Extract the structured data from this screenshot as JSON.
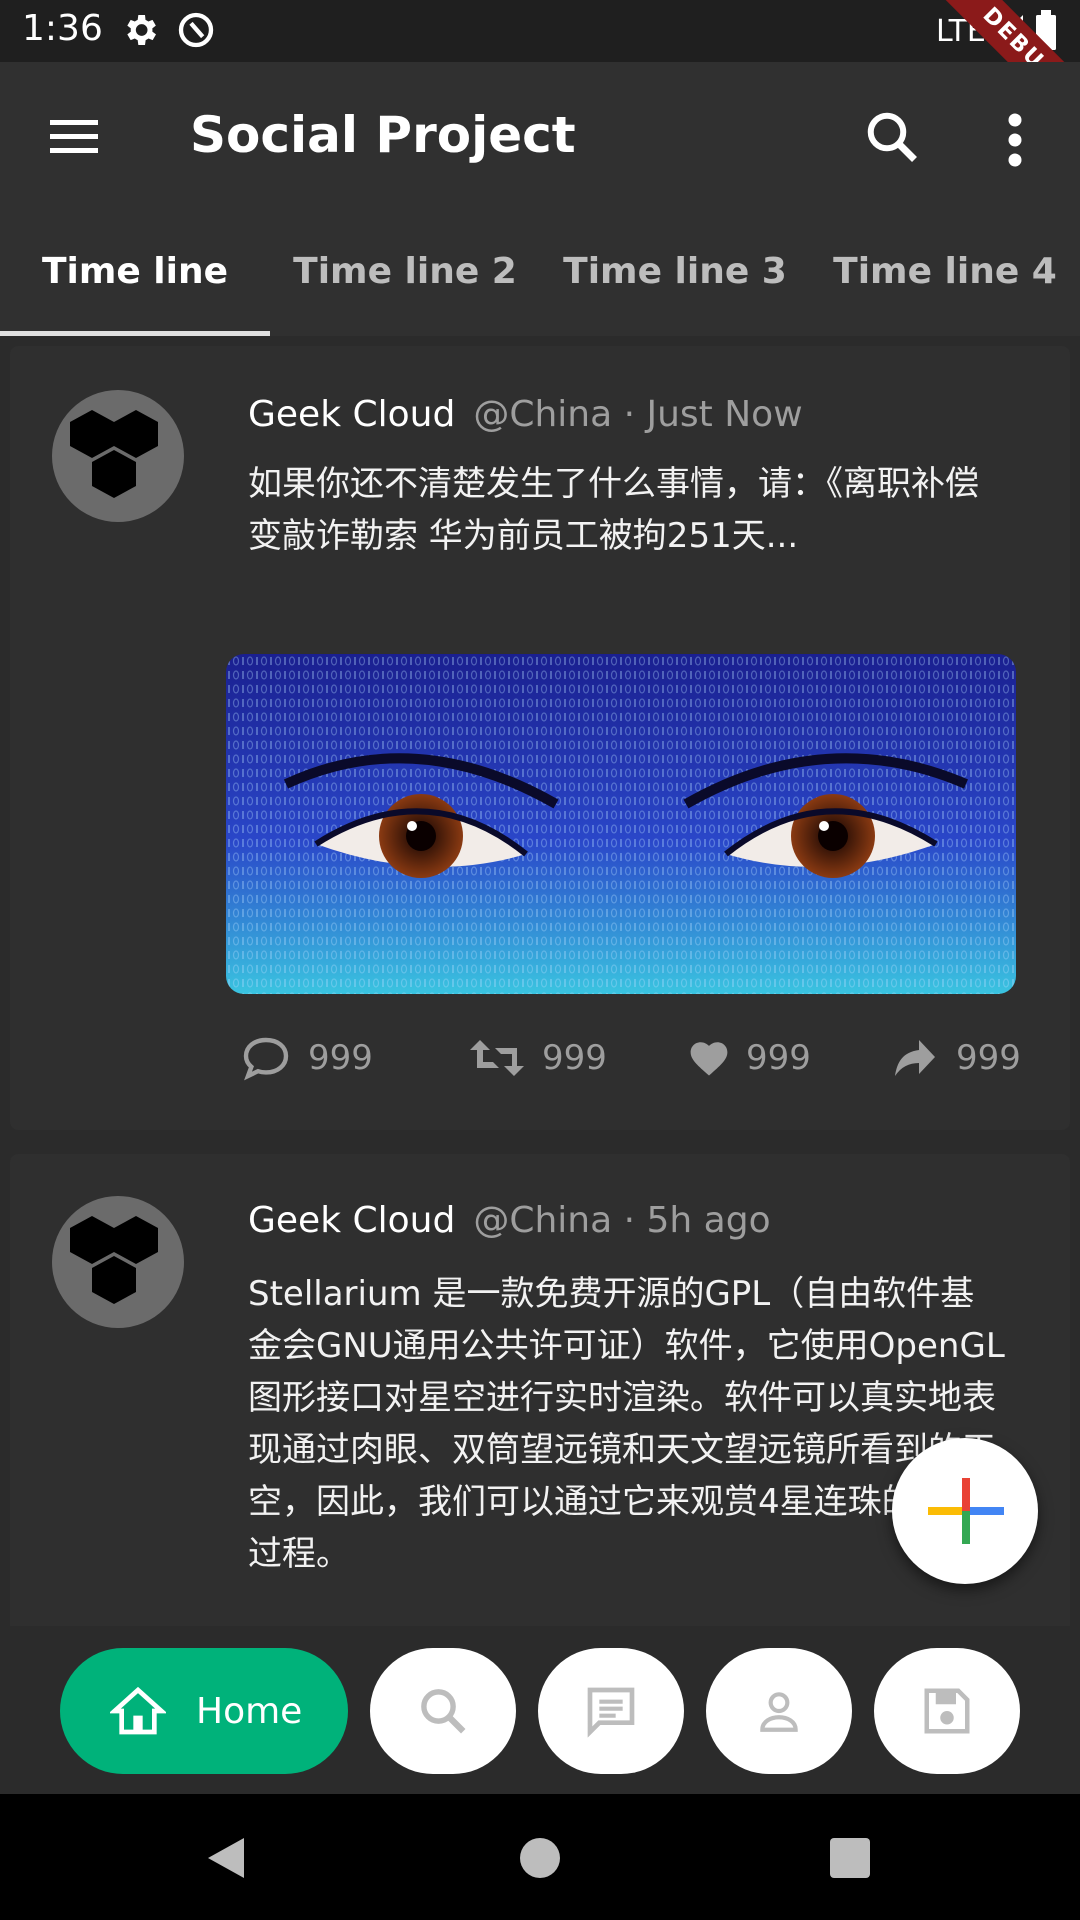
{
  "status_bar": {
    "time": "1:36",
    "network": "LTE",
    "debug_label": "DEBUG",
    "icons": [
      "settings-icon",
      "data-saver-icon",
      "signal-icon",
      "battery-icon"
    ]
  },
  "app_bar": {
    "title": "Social Project",
    "icons": [
      "menu-icon",
      "search-icon",
      "more-vert-icon"
    ]
  },
  "tabs": [
    {
      "label": "Time line",
      "active": true
    },
    {
      "label": "Time line 2",
      "active": false
    },
    {
      "label": "Time line 3",
      "active": false
    },
    {
      "label": "Time line 4",
      "active": false
    }
  ],
  "posts": [
    {
      "author": "Geek Cloud",
      "meta": "@China · Just Now",
      "text": "如果你还不清楚发生了什么事情，请：《离职补偿变敲诈勒索 华为前员工被拘251天...",
      "image": "blue-binary-eyes-image",
      "actions": {
        "comments": "999",
        "retweets": "999",
        "likes": "999",
        "shares": "999"
      }
    },
    {
      "author": "Geek Cloud",
      "meta": "@China · 5h ago",
      "text": "Stellarium 是一款免费开源的GPL（自由软件基金会GNU通用公共许可证）软件，它使用OpenGL图形接口对星空进行实时渲染。软件可以真实地表现通过肉眼、双筒望远镜和天文望远镜所看到的天空，因此，我们可以通过它来观赏4星连珠的完整过程。"
    }
  ],
  "fab": {
    "icon": "add-icon"
  },
  "bottom_nav": {
    "home_label": "Home",
    "items": [
      "home-icon",
      "search-icon",
      "chat-icon",
      "account-icon",
      "save-icon"
    ]
  },
  "colors": {
    "accent": "#00b27a",
    "background": "#2b2b2b",
    "app_bar": "#303030"
  }
}
